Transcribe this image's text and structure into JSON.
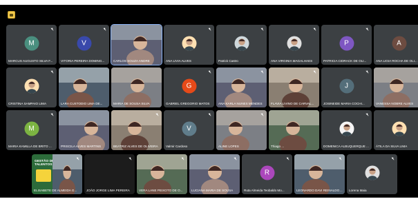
{
  "topbar": {
    "app_icon": "meeting-app-icon"
  },
  "colors": {
    "background": "#000000",
    "tile": "#3c4043",
    "active_outline": "#8ab4f8",
    "name_text": "#ffffff"
  },
  "participants": [
    {
      "name": "MARCUS AUGUSTO SILVA F...",
      "kind": "avatar",
      "initial": "M",
      "color": "#4a8f7f",
      "muted": true
    },
    {
      "name": "VITORIA PEREIRA DOMING...",
      "kind": "avatar",
      "initial": "V",
      "color": "#3949ab",
      "muted": true
    },
    {
      "name": "CARLOS SOUZA ANDRE",
      "kind": "video",
      "muted": false,
      "active": true
    },
    {
      "name": "ANA LIVIA ALVES",
      "kind": "photo",
      "muted": true
    },
    {
      "name": "Patrick Castro",
      "kind": "photo",
      "muted": true
    },
    {
      "name": "ANA VIRGINIA MAGALHAES",
      "kind": "photo",
      "muted": true
    },
    {
      "name": "PATRICIA CIDRACK DE OLI...",
      "kind": "avatar",
      "initial": "P",
      "color": "#7e57c2",
      "muted": true
    },
    {
      "name": "ANA LIGIA ROCHA DE OLI...",
      "kind": "avatar",
      "initial": "A",
      "color": "#6d4c41",
      "muted": true
    },
    {
      "name": "CRISTINA SAMPAIO LIMA",
      "kind": "photo",
      "muted": true
    },
    {
      "name": "LARA CUSTODIO LIMA DE...",
      "kind": "video",
      "muted": false
    },
    {
      "name": "MARIA DE SOUSA SILVA",
      "kind": "video",
      "muted": false
    },
    {
      "name": "GABRIEL GREGORIO MATOS",
      "kind": "avatar",
      "initial": "G",
      "color": "#e64a19",
      "muted": true
    },
    {
      "name": "ANA KARLA NUNES MENDES",
      "kind": "video",
      "muted": true
    },
    {
      "name": "FLAVIA LIVINO DE CARVAL...",
      "kind": "video",
      "muted": true
    },
    {
      "name": "JOSINEIDE MARIA COCHI...",
      "kind": "avatar",
      "initial": "J",
      "color": "#546e7a",
      "muted": true
    },
    {
      "name": "VANESSA NOBRE ALVES",
      "kind": "video",
      "muted": true
    },
    {
      "name": "MARIA KAMILLA DE BRITO ...",
      "kind": "avatar",
      "initial": "M",
      "color": "#7cb342",
      "muted": true
    },
    {
      "name": "PRISCILA ALVES MARTINS",
      "kind": "video",
      "muted": false
    },
    {
      "name": "BEATRIZ ALVES DE OLIVEIRA",
      "kind": "video",
      "muted": true
    },
    {
      "name": "Valmir Cardoso",
      "kind": "avatar",
      "initial": "V",
      "color": "#607d8b",
      "muted": true
    },
    {
      "name": "ALINE LOPES",
      "kind": "video",
      "muted": true
    },
    {
      "name": "Thiago ...",
      "kind": "video",
      "muted": false
    },
    {
      "name": "DOMENICA ALBUQUERQUE ...",
      "kind": "photo",
      "muted": true
    },
    {
      "name": "ÁTILA DA SILVA LIMA",
      "kind": "photo",
      "muted": true
    },
    {
      "name": "ELISABETE DE ALMEIDA G...",
      "kind": "banner",
      "banner_text": "GESTÃO DE TALENTOS",
      "muted": true
    },
    {
      "name": "JOÃO JORGE LIMA PEREIRA",
      "kind": "dark",
      "muted": true
    },
    {
      "name": "VERA LANE PEIXOTO DE O...",
      "kind": "video",
      "muted": true
    },
    {
      "name": "LUCIANA MARIA DE SOUSA",
      "kind": "video",
      "muted": true
    },
    {
      "name": "Ruta Almeida Teobaldo Mo...",
      "kind": "avatar",
      "initial": "R",
      "color": "#ab47bc",
      "muted": true
    },
    {
      "name": "LEONARDO DAVI REINALDO ...",
      "kind": "video",
      "muted": true
    },
    {
      "name": "Lorena Maia",
      "kind": "photo",
      "muted": true
    }
  ]
}
